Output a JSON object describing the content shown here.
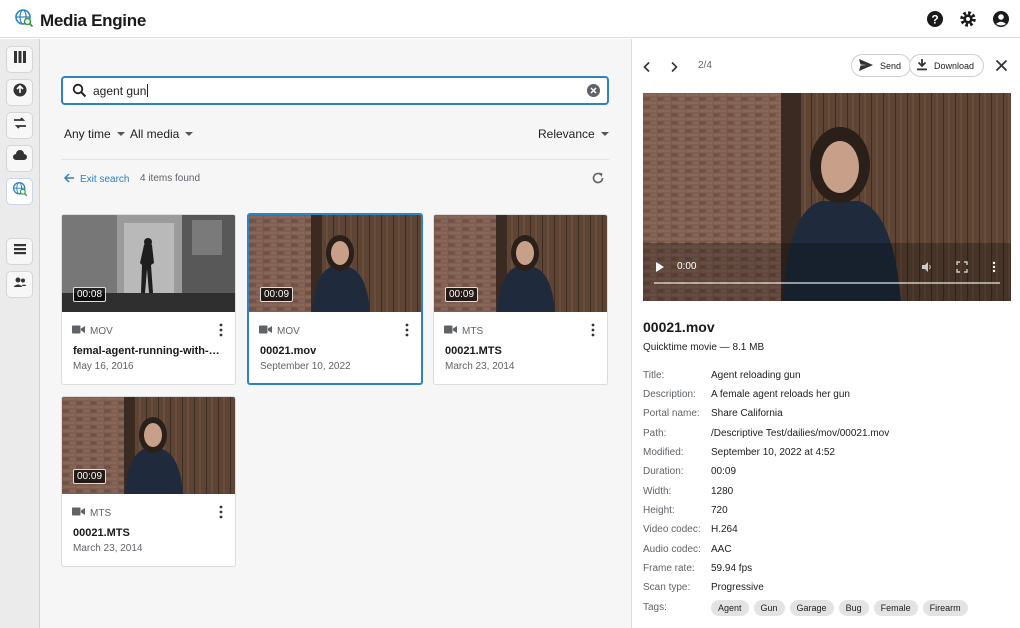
{
  "app": {
    "title": "Media Engine"
  },
  "search": {
    "query": "agent gun"
  },
  "filters": {
    "time": "Any time",
    "media": "All media",
    "sort": "Relevance"
  },
  "results": {
    "exit_label": "Exit search",
    "count_label": "4 items found"
  },
  "cards": [
    {
      "duration": "00:08",
      "type": "MOV",
      "name": "femal-agent-running-with-gun.mov",
      "date": "May 16, 2016"
    },
    {
      "duration": "00:09",
      "type": "MOV",
      "name": "00021.mov",
      "date": "September 10, 2022"
    },
    {
      "duration": "00:09",
      "type": "MTS",
      "name": "00021.MTS",
      "date": "March 23, 2014"
    },
    {
      "duration": "00:09",
      "type": "MTS",
      "name": "00021.MTS",
      "date": "March 23, 2014"
    }
  ],
  "panel": {
    "pager": "2/4",
    "send_label": "Send",
    "download_label": "Download",
    "video_time": "0:00",
    "name": "00021.mov",
    "subtitle": "Quicktime movie — 8.1 MB",
    "meta": [
      {
        "key": "Title:",
        "value": "Agent reloading gun"
      },
      {
        "key": "Description:",
        "value": "A female agent reloads her gun"
      },
      {
        "key": "Portal name:",
        "value": "Share California"
      },
      {
        "key": "Path:",
        "value": "/Descriptive Test/dailies/mov/00021.mov"
      },
      {
        "key": "Modified:",
        "value": "September 10, 2022 at 4:52"
      },
      {
        "key": "Duration:",
        "value": "00:09"
      },
      {
        "key": "Width:",
        "value": "1280"
      },
      {
        "key": "Height:",
        "value": "720"
      },
      {
        "key": "Video codec:",
        "value": "H.264"
      },
      {
        "key": "Audio codec:",
        "value": "AAC"
      },
      {
        "key": "Frame rate:",
        "value": "59.94 fps"
      },
      {
        "key": "Scan type:",
        "value": "Progressive"
      }
    ],
    "tags_label": "Tags:",
    "tags": [
      "Agent",
      "Gun",
      "Garage",
      "Bug",
      "Female",
      "Firearm"
    ]
  },
  "colors": {
    "accent": "#2f82c4",
    "text": "#202124",
    "muted": "#5f6368"
  },
  "icons": [
    "globe-search-icon",
    "help-icon",
    "settings-icon",
    "account-icon",
    "search-icon",
    "clear-icon",
    "refresh-icon",
    "video-camera-icon",
    "more-vert-icon",
    "chevron-left-icon",
    "chevron-right-icon",
    "send-icon",
    "download-icon",
    "close-icon",
    "play-icon",
    "volume-icon",
    "fullscreen-icon"
  ]
}
